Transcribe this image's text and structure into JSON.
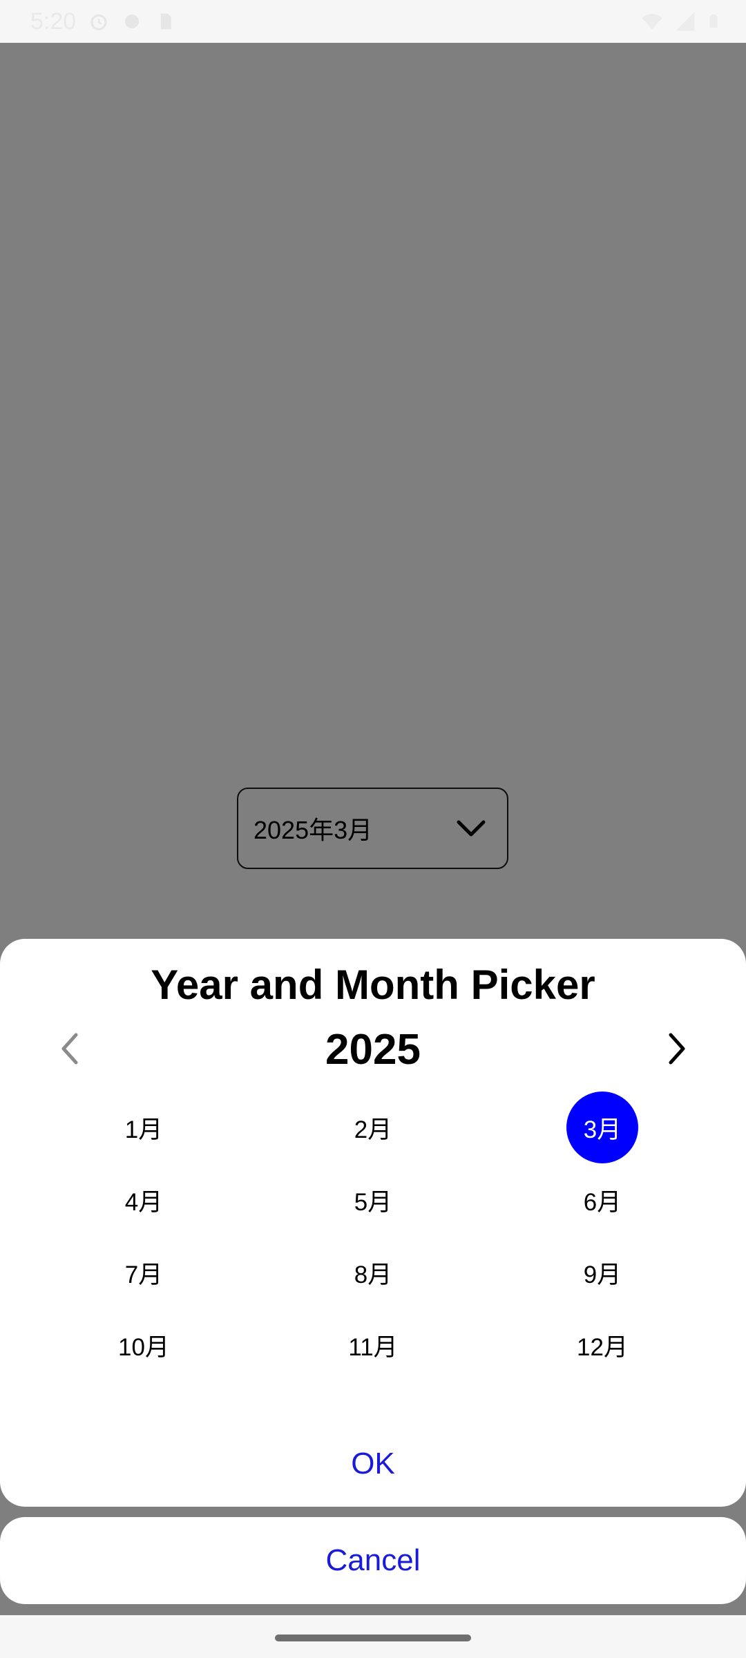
{
  "status_bar": {
    "time": "5:20",
    "icons_left": [
      "alarm-icon",
      "notification-icon",
      "sd-card-icon"
    ],
    "icons_right": [
      "wifi-icon",
      "signal-icon",
      "battery-icon"
    ]
  },
  "date_field": {
    "value": "2025年3月",
    "icon": "chevron-down-icon"
  },
  "dialog": {
    "title": "Year and Month Picker",
    "year": "2025",
    "prev_icon": "chevron-left-icon",
    "next_icon": "chevron-right-icon",
    "months": [
      "1月",
      "2月",
      "3月",
      "4月",
      "5月",
      "6月",
      "7月",
      "8月",
      "9月",
      "10月",
      "11月",
      "12月"
    ],
    "selected_month": "3月",
    "ok_label": "OK",
    "cancel_label": "Cancel"
  },
  "colors": {
    "accent": "#0000ff",
    "button_text": "#1a1adb",
    "scrim": "#7f7f7f",
    "sheet": "#ffffff"
  }
}
